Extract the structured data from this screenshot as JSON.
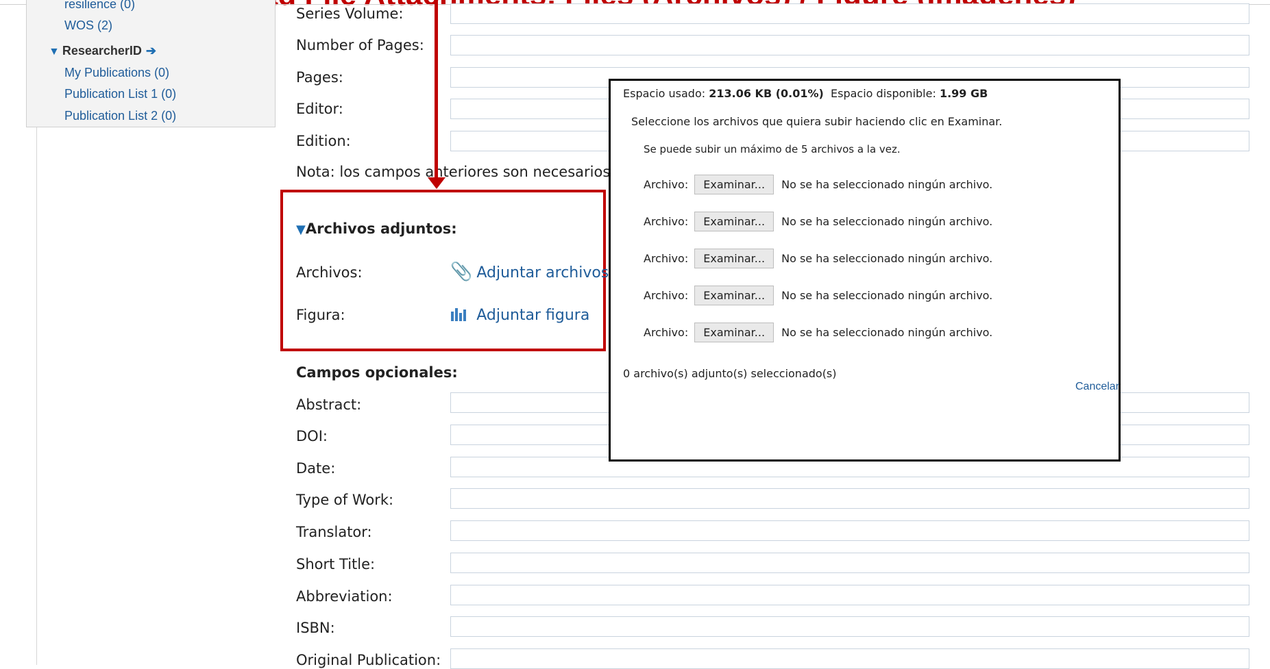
{
  "banner": {
    "title": "Upload File Attachments: Files (Archivos) / Figure (Imágenes)"
  },
  "sidebar": {
    "cut_item": "resilience (0)",
    "wos": "WOS (2)",
    "researcherid_head": "ResearcherID",
    "researcherid_arrow": "➔",
    "items": [
      "My Publications (0)",
      "Publication List 1 (0)",
      "Publication List 2 (0)"
    ]
  },
  "form": {
    "fields_top": [
      "Series Volume:",
      "Number of Pages:",
      "Pages:",
      "Editor:",
      "Edition:"
    ],
    "note": "Nota: los campos anteriores son necesarios",
    "attachments": {
      "title": "Archivos adjuntos:",
      "files_label": "Archivos:",
      "files_link": "Adjuntar archivos",
      "figure_label": "Figura:",
      "figure_link": "Adjuntar figura"
    },
    "optional_head": "Campos opcionales:",
    "fields_optional": [
      "Abstract:",
      "DOI:",
      "Date:",
      "Type of Work:",
      "Translator:",
      "Short Title:",
      "Abbreviation:",
      "ISBN:",
      "Original Publication:"
    ]
  },
  "dialog": {
    "usage_label": "Espacio usado:",
    "usage_value": "213.06 KB (0.01%)",
    "available_label": "Espacio disponible:",
    "available_value": "1.99 GB",
    "instruction": "Seleccione los archivos que quiera subir haciendo clic en Examinar.",
    "max_note": "Se puede subir un máximo de 5 archivos a la vez.",
    "file_rows": [
      {
        "label": "Archivo:",
        "button": "Examinar...",
        "status": "No se ha seleccionado ningún archivo."
      },
      {
        "label": "Archivo:",
        "button": "Examinar...",
        "status": "No se ha seleccionado ningún archivo."
      },
      {
        "label": "Archivo:",
        "button": "Examinar...",
        "status": "No se ha seleccionado ningún archivo."
      },
      {
        "label": "Archivo:",
        "button": "Examinar...",
        "status": "No se ha seleccionado ningún archivo."
      },
      {
        "label": "Archivo:",
        "button": "Examinar...",
        "status": "No se ha seleccionado ningún archivo."
      }
    ],
    "count": "0 archivo(s) adjunto(s) seleccionado(s)",
    "cancel": "Cancelar"
  },
  "colors": {
    "annotation_red": "#c00000",
    "link_blue": "#1f5c99"
  },
  "icons": {
    "paperclip": "paperclip-icon",
    "figure": "bar-chart-icon",
    "triangle": "triangle-down-icon"
  }
}
